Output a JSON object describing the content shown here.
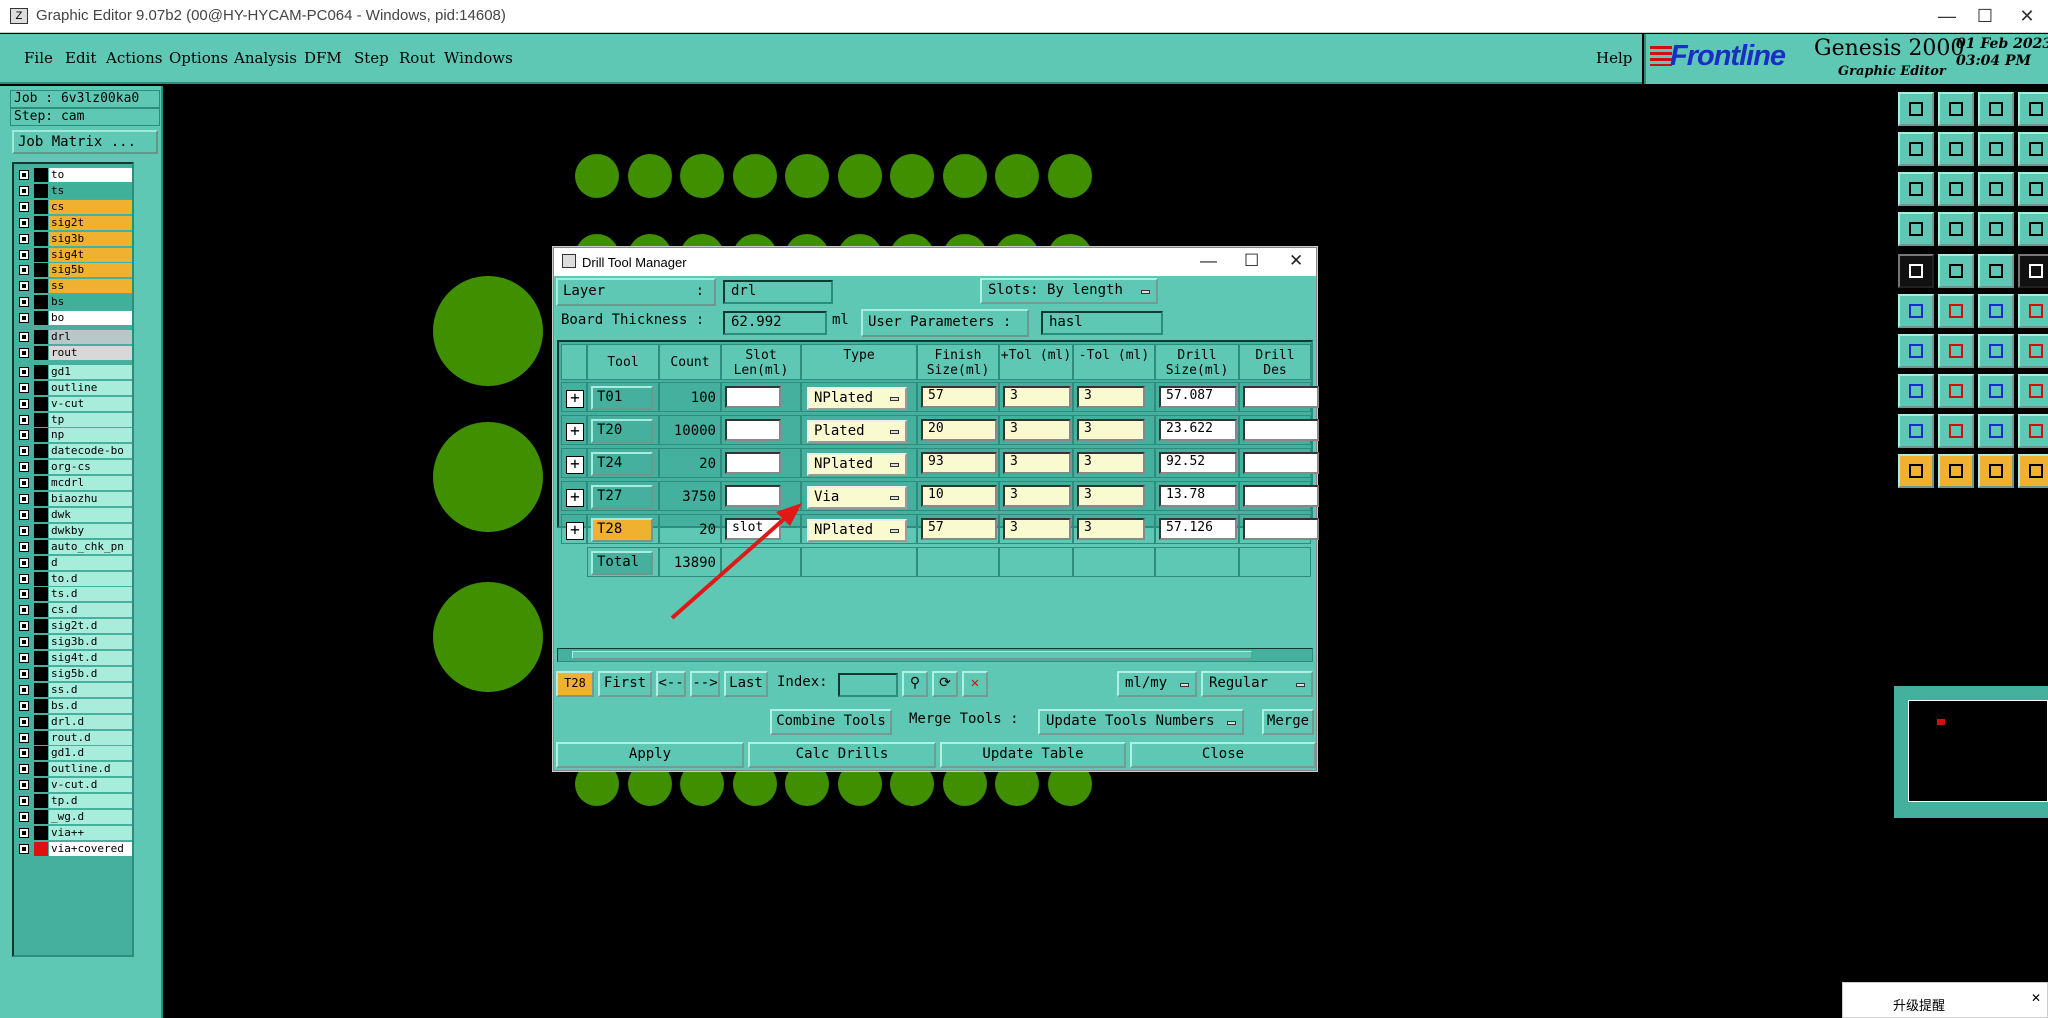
{
  "window": {
    "title": "Graphic Editor 9.07b2 (00@HY-HYCAM-PC064 - Windows, pid:14608)"
  },
  "menu": {
    "items": [
      "File",
      "Edit",
      "Actions",
      "Options",
      "Analysis",
      "DFM",
      "Step",
      "Rout",
      "Windows"
    ],
    "help": "Help"
  },
  "brand": {
    "frontline": "Frontline",
    "genesis": "Genesis 2000",
    "subtitle": "Graphic Editor",
    "date": "01 Feb 2023",
    "time": "03:04 PM"
  },
  "job": {
    "job": "Job : 6v3lz00ka0",
    "step": "Step: cam",
    "matrix": "Job Matrix ..."
  },
  "layers": [
    {
      "name": "to",
      "color": "#ffffff"
    },
    {
      "name": "ts",
      "color": "#3fb09a"
    },
    {
      "name": "cs",
      "color": "#f0b030"
    },
    {
      "name": "sig2t",
      "color": "#f0b030"
    },
    {
      "name": "sig3b",
      "color": "#f0b030"
    },
    {
      "name": "sig4t",
      "color": "#f0b030"
    },
    {
      "name": "sig5b",
      "color": "#f0b030"
    },
    {
      "name": "ss",
      "color": "#f0b030"
    },
    {
      "name": "bs",
      "color": "#3fb09a"
    },
    {
      "name": "bo",
      "color": "#ffffff"
    },
    {
      "name": "drl",
      "color": "#b8c8c8"
    },
    {
      "name": "rout",
      "color": "#d8d8d8"
    },
    {
      "name": "gd1",
      "color": "#a8ecdc"
    },
    {
      "name": "outline",
      "color": "#a8ecdc"
    },
    {
      "name": "v-cut",
      "color": "#a8ecdc"
    },
    {
      "name": "tp",
      "color": "#a8ecdc"
    },
    {
      "name": "np",
      "color": "#a8ecdc"
    },
    {
      "name": "datecode-bo",
      "color": "#a8ecdc"
    },
    {
      "name": "org-cs",
      "color": "#a8ecdc"
    },
    {
      "name": "mcdrl",
      "color": "#a8ecdc"
    },
    {
      "name": "biaozhu",
      "color": "#a8ecdc"
    },
    {
      "name": "dwk",
      "color": "#a8ecdc"
    },
    {
      "name": "dwkby",
      "color": "#a8ecdc"
    },
    {
      "name": "auto_chk_pn",
      "color": "#a8ecdc"
    },
    {
      "name": "d",
      "color": "#a8ecdc"
    },
    {
      "name": "to.d",
      "color": "#a8ecdc"
    },
    {
      "name": "ts.d",
      "color": "#a8ecdc"
    },
    {
      "name": "cs.d",
      "color": "#a8ecdc"
    },
    {
      "name": "sig2t.d",
      "color": "#a8ecdc"
    },
    {
      "name": "sig3b.d",
      "color": "#a8ecdc"
    },
    {
      "name": "sig4t.d",
      "color": "#a8ecdc"
    },
    {
      "name": "sig5b.d",
      "color": "#a8ecdc"
    },
    {
      "name": "ss.d",
      "color": "#a8ecdc"
    },
    {
      "name": "bs.d",
      "color": "#a8ecdc"
    },
    {
      "name": "drl.d",
      "color": "#a8ecdc"
    },
    {
      "name": "rout.d",
      "color": "#a8ecdc"
    },
    {
      "name": "gd1.d",
      "color": "#a8ecdc"
    },
    {
      "name": "outline.d",
      "color": "#a8ecdc"
    },
    {
      "name": "v-cut.d",
      "color": "#a8ecdc"
    },
    {
      "name": "tp.d",
      "color": "#a8ecdc"
    },
    {
      "name": "_wg.d",
      "color": "#a8ecdc"
    },
    {
      "name": "via++",
      "color": "#a8ecdc"
    },
    {
      "name": "via+covered",
      "color": "#ffffff"
    }
  ],
  "dialog": {
    "title": "Drill Tool Manager",
    "layer_label": "Layer",
    "layer_value": "drl",
    "slots_label": "Slots:",
    "slots_value": "By length",
    "thickness_label": "Board Thickness :",
    "thickness_value": "62.992",
    "thickness_unit": "ml",
    "userparams_label": "User Parameters :",
    "userparams_value": "hasl",
    "columns": [
      "Tool",
      "Count",
      "Slot Len(ml)",
      "Type",
      "Finish Size(ml)",
      "+Tol (ml)",
      "-Tol (ml)",
      "Drill Size(ml)",
      "Drill Des"
    ],
    "rows": [
      {
        "tool": "T01",
        "count": "100",
        "slot": "",
        "type": "NPlated",
        "finish": "57",
        "ptol": "3",
        "mtol": "3",
        "drill": "57.087",
        "des": ""
      },
      {
        "tool": "T20",
        "count": "10000",
        "slot": "",
        "type": "Plated",
        "finish": "20",
        "ptol": "3",
        "mtol": "3",
        "drill": "23.622",
        "des": ""
      },
      {
        "tool": "T24",
        "count": "20",
        "slot": "",
        "type": "NPlated",
        "finish": "93",
        "ptol": "3",
        "mtol": "3",
        "drill": "92.52",
        "des": ""
      },
      {
        "tool": "T27",
        "count": "3750",
        "slot": "",
        "type": "Via",
        "finish": "10",
        "ptol": "3",
        "mtol": "3",
        "drill": "13.78",
        "des": ""
      },
      {
        "tool": "T28",
        "count": "20",
        "slot": "slot",
        "type": "NPlated",
        "finish": "57",
        "ptol": "3",
        "mtol": "3",
        "drill": "57.126",
        "des": ""
      }
    ],
    "total_label": "Total",
    "total_count": "13890",
    "nav": {
      "current": "T28",
      "first": "First",
      "prev": "<--",
      "next": "-->",
      "last": "Last",
      "index_label": "Index:",
      "units": "ml/my",
      "mode": "Regular"
    },
    "actions": {
      "combine": "Combine Tools",
      "merge_tools": "Merge Tools :",
      "update_numbers": "Update Tools Numbers",
      "merge": "Merge"
    },
    "bottom": {
      "apply": "Apply",
      "calc": "Calc Drills",
      "update": "Update Table",
      "close": "Close"
    }
  },
  "notification": {
    "text": "升级提醒"
  }
}
